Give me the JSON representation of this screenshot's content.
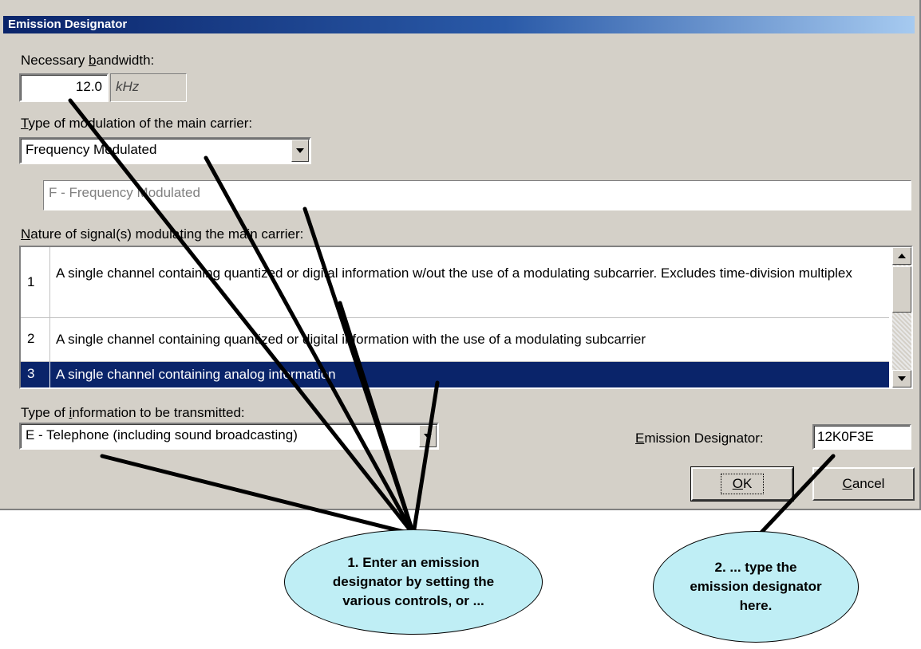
{
  "dialog": {
    "title": "Emission Designator",
    "bandwidth": {
      "label_pre": "Necessary ",
      "label_key": "b",
      "label_post": "andwidth:",
      "value": "12.0",
      "unit": "kHz"
    },
    "modulation": {
      "label_key": "T",
      "label_post": "ype of modulation of the main carrier:",
      "selected": "Frequency Modulated",
      "code_text": "F - Frequency Modulated"
    },
    "nature": {
      "label_key": "N",
      "label_post": "ature of signal(s) modulating the main carrier:",
      "items": [
        {
          "num": "1",
          "text": "A single channel containing quantized or digital information w/out the use of a modulating subcarrier. Excludes time-division multiplex"
        },
        {
          "num": "2",
          "text": "A single channel containing quantized or digital information with the use of a modulating subcarrier"
        },
        {
          "num": "3",
          "text": "A single channel containing analog information"
        }
      ],
      "selected_index": 2
    },
    "info_type": {
      "label_pre": "Type of ",
      "label_key": "i",
      "label_post": "nformation to be transmitted:",
      "selected": "E - Telephone (including sound broadcasting)"
    },
    "designator": {
      "label_key": "E",
      "label_post": "mission Designator:",
      "value": "12K0F3E"
    },
    "buttons": {
      "ok_key": "O",
      "ok_post": "K",
      "cancel_key": "C",
      "cancel_post": "ancel"
    }
  },
  "callouts": {
    "first": "1.  Enter an emission\ndesignator by setting the\nvarious controls, or ...",
    "second": "2.  ... type the\nemission designator\nhere."
  },
  "colors": {
    "dialog_bg": "#d4d0c8",
    "title_bar": "#0a246a",
    "selection": "#0a246a",
    "bubble_fill": "#bfeef5"
  }
}
